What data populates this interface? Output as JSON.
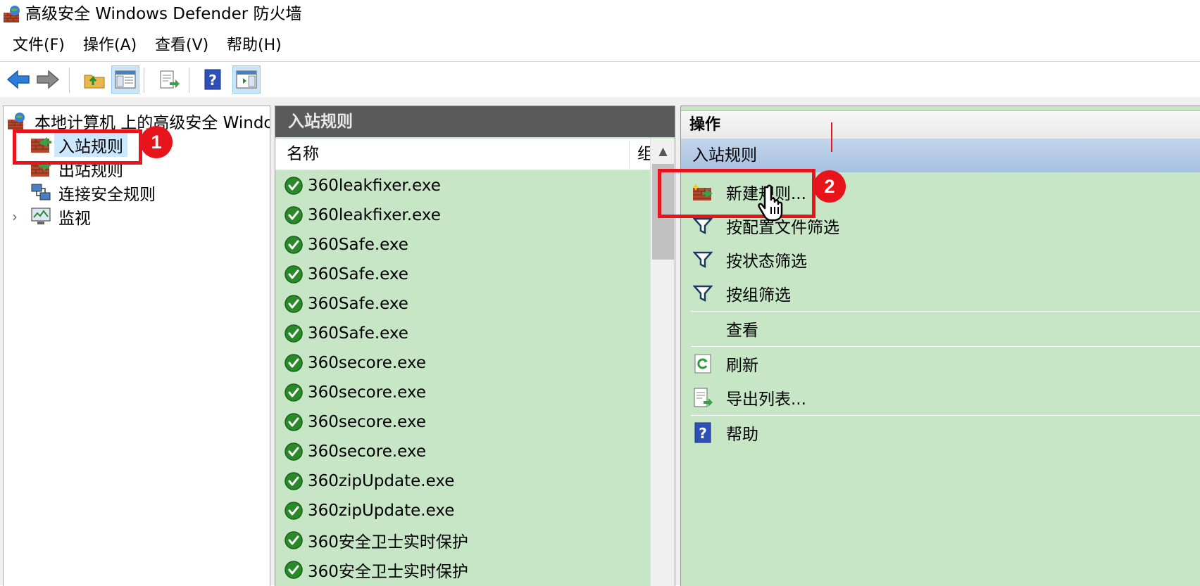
{
  "window": {
    "title": "高级安全 Windows Defender 防火墙"
  },
  "menubar": {
    "items": [
      "文件(F)",
      "操作(A)",
      "查看(V)",
      "帮助(H)"
    ]
  },
  "toolbar": {
    "buttons": [
      "back-arrow-icon",
      "forward-arrow-icon",
      "up-folder-icon",
      "show-hide-tree-icon",
      "export-list-icon",
      "help-icon",
      "show-hide-action-pane-icon"
    ]
  },
  "tree": {
    "root": "本地计算机 上的高级安全 Windows Defender 防火墙",
    "items": [
      {
        "label": "入站规则",
        "selected": true
      },
      {
        "label": "出站规则"
      },
      {
        "label": "连接安全规则"
      },
      {
        "label": "监视",
        "expandable": true
      }
    ]
  },
  "rules_pane": {
    "header": "入站规则",
    "columns": {
      "name": "名称",
      "group": "组"
    },
    "rows": [
      "360leakfixer.exe",
      "360leakfixer.exe",
      "360Safe.exe",
      "360Safe.exe",
      "360Safe.exe",
      "360Safe.exe",
      "360secore.exe",
      "360secore.exe",
      "360secore.exe",
      "360secore.exe",
      "360zipUpdate.exe",
      "360zipUpdate.exe",
      "360安全卫士实时保护",
      "360安全卫士实时保护"
    ]
  },
  "actions_pane": {
    "header": "操作",
    "section": "入站规则",
    "items": [
      {
        "label": "新建规则...",
        "icon": "new-rule-icon"
      },
      {
        "label": "按配置文件筛选",
        "icon": "filter-icon"
      },
      {
        "label": "按状态筛选",
        "icon": "filter-icon"
      },
      {
        "label": "按组筛选",
        "icon": "filter-icon"
      },
      {
        "label": "查看",
        "icon": ""
      },
      {
        "label": "刷新",
        "icon": "refresh-icon"
      },
      {
        "label": "导出列表...",
        "icon": "export-list-icon"
      },
      {
        "label": "帮助",
        "icon": "help-icon"
      }
    ]
  },
  "annotations": {
    "badge1": "1",
    "badge2": "2",
    "color": "#e8141c"
  },
  "colors": {
    "pane_green": "#c6e6c6",
    "selection_blue": "#cce8ff",
    "section_blue": "#a6c0e0"
  }
}
